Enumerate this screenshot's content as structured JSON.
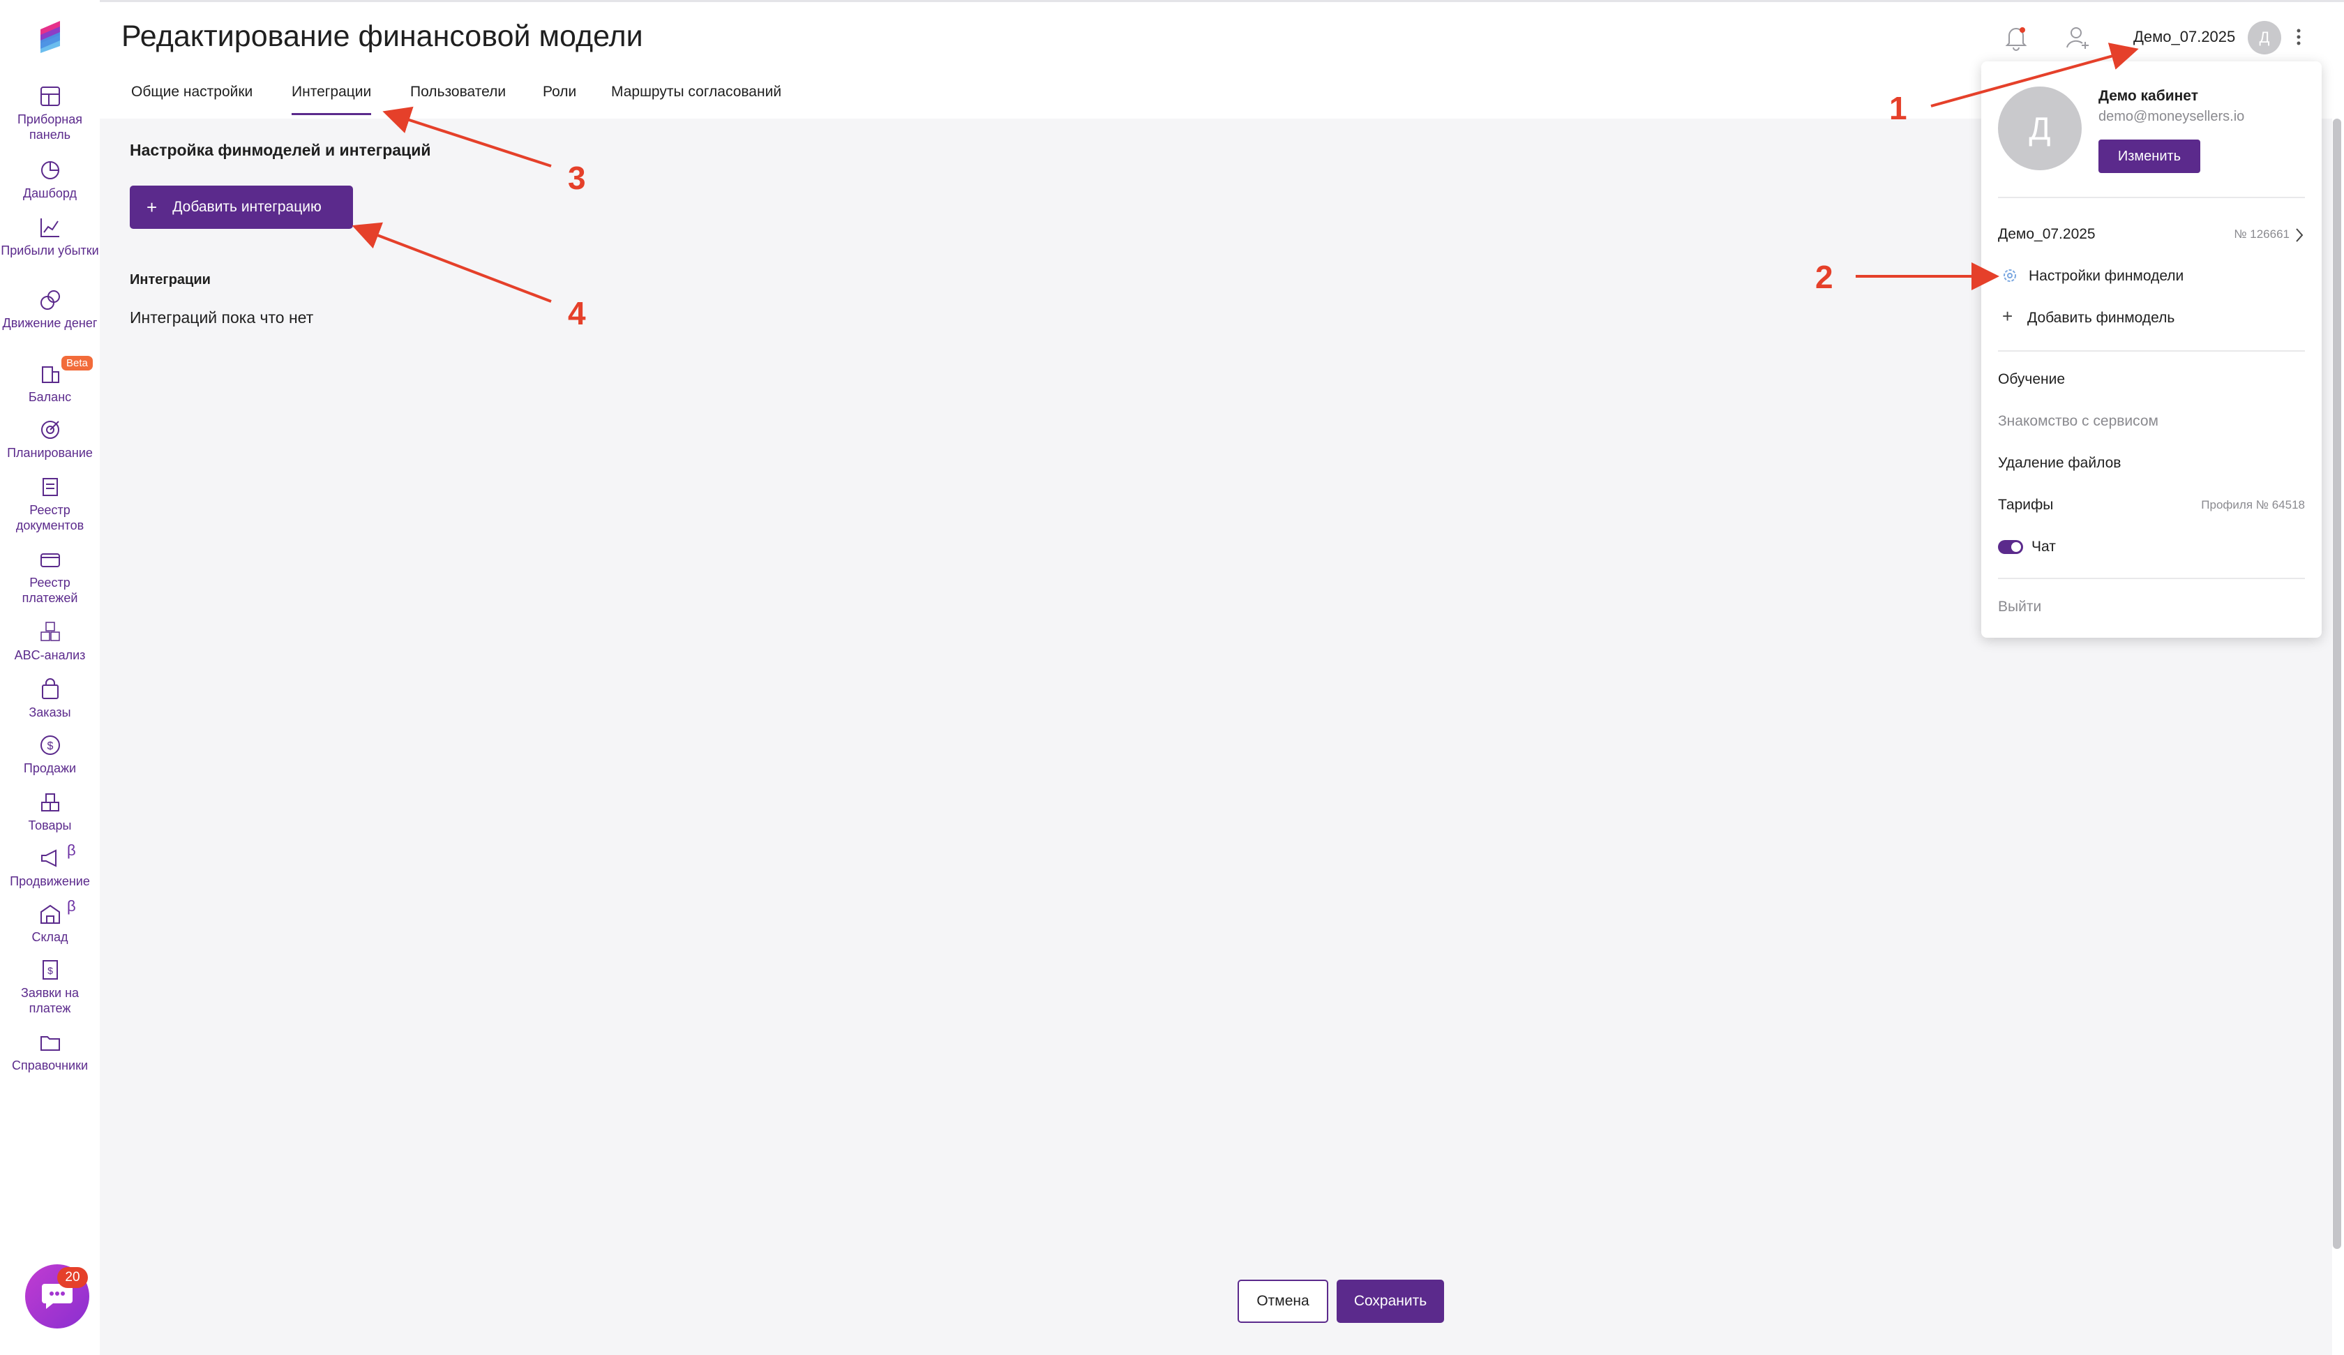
{
  "page": {
    "title": "Редактирование финансовой модели"
  },
  "tabs": [
    {
      "label": "Общие настройки",
      "active": false
    },
    {
      "label": "Интеграции",
      "active": true
    },
    {
      "label": "Пользователи",
      "active": false
    },
    {
      "label": "Роли",
      "active": false
    },
    {
      "label": "Маршруты согласований",
      "active": false
    }
  ],
  "sidebar": {
    "items": [
      {
        "label": "Приборная панель",
        "icon": "dashboard-grid-icon"
      },
      {
        "label": "Дашборд",
        "icon": "pie-chart-icon"
      },
      {
        "label": "Прибыли убытки",
        "icon": "line-chart-icon"
      },
      {
        "label": "Движение денег",
        "icon": "coins-icon"
      },
      {
        "label": "Баланс",
        "icon": "building-icon",
        "badge": "Beta"
      },
      {
        "label": "Планирование",
        "icon": "target-icon"
      },
      {
        "label": "Реестр документов",
        "icon": "documents-icon"
      },
      {
        "label": "Реестр платежей",
        "icon": "wallet-icon"
      },
      {
        "label": "ABC-анализ",
        "icon": "abc-icon"
      },
      {
        "label": "Заказы",
        "icon": "shopping-bag-icon"
      },
      {
        "label": "Продажи",
        "icon": "dollar-icon"
      },
      {
        "label": "Товары",
        "icon": "boxes-icon"
      },
      {
        "label": "Продвижение",
        "icon": "megaphone-icon",
        "badge": "β"
      },
      {
        "label": "Склад",
        "icon": "warehouse-icon",
        "badge": "β"
      },
      {
        "label": "Заявки на платеж",
        "icon": "payment-request-icon"
      },
      {
        "label": "Справочники",
        "icon": "folder-icon"
      }
    ]
  },
  "main": {
    "section_title": "Настройка финмоделей и интеграций",
    "add_button_label": "Добавить интеграцию",
    "add_button_icon": "+",
    "integrations_title": "Интеграции",
    "empty_text": "Интеграций пока что нет",
    "cancel_label": "Отмена",
    "save_label": "Сохранить"
  },
  "header": {
    "account_name": "Демо_07.2025",
    "avatar_letter": "Д"
  },
  "dropdown": {
    "avatar_letter": "Д",
    "name": "Демо кабинет",
    "email": "demo@moneysellers.io",
    "change_label": "Изменить",
    "model_name": "Демо_07.2025",
    "model_number": "№ 126661",
    "settings_label": "Настройки финмодели",
    "add_model_label": "Добавить финмодель",
    "training_label": "Обучение",
    "intro_label": "Знакомство с сервисом",
    "delete_files_label": "Удаление файлов",
    "tariffs_label": "Тарифы",
    "profile_number": "Профиля № 64518",
    "chat_label": "Чат",
    "chat_enabled": true,
    "logout_label": "Выйти"
  },
  "annotations": [
    "1",
    "2",
    "3",
    "4"
  ],
  "chat_widget": {
    "badge_count": "20"
  },
  "colors": {
    "accent": "#5b2a8c",
    "annotation": "#e5402a",
    "content_bg": "#f5f5f7"
  }
}
